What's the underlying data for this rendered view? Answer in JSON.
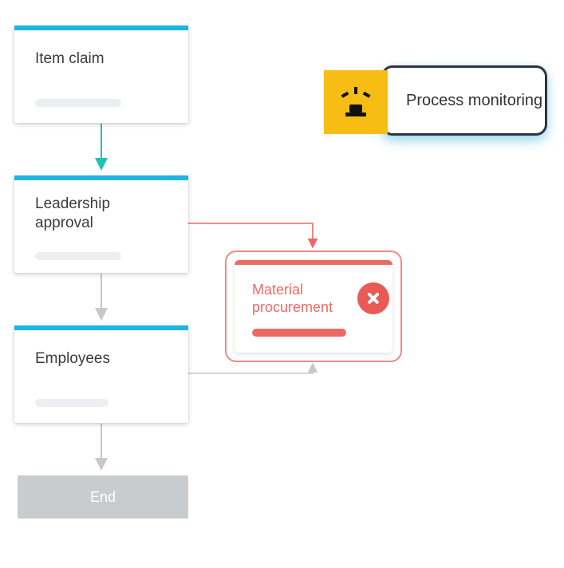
{
  "flow": {
    "nodes": [
      {
        "id": "item_claim",
        "label": "Item claim"
      },
      {
        "id": "approval",
        "label": "Leadership approval"
      },
      {
        "id": "employees",
        "label": "Employees"
      }
    ],
    "end_label": "End"
  },
  "error_node": {
    "label": "Material procurement"
  },
  "monitoring": {
    "label": "Process monitoring"
  },
  "colors": {
    "accent_blue": "#1cb5e4",
    "teal_arrow": "#1fc2b9",
    "grey_arrow": "#c6c8cb",
    "red_arrow": "#ed6a64",
    "amber": "#f7bd14",
    "error_red": "#ed6a64",
    "monitor_border": "#2d3446"
  }
}
